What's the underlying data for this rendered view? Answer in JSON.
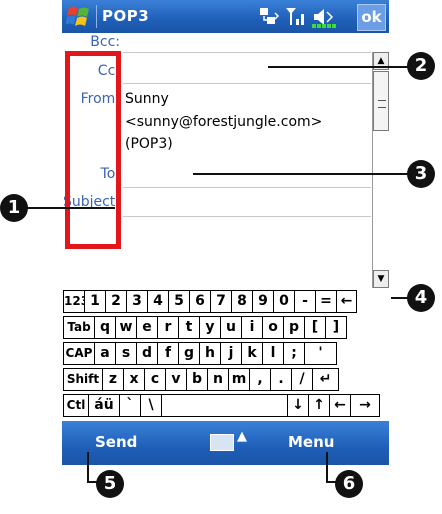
{
  "titlebar": {
    "title": "POP3",
    "ok_label": "ok"
  },
  "form": {
    "bcc_label": "Bcc:",
    "cc_label": "Cc:",
    "from_label": "From:",
    "from_name": "Sunny",
    "from_email": "<sunny@forestjungle.com>",
    "from_account": "(POP3)",
    "to_label": "To:",
    "subject_label": "Subject:"
  },
  "keyboard": {
    "rows": [
      [
        "123",
        "1",
        "2",
        "3",
        "4",
        "5",
        "6",
        "7",
        "8",
        "9",
        "0",
        "-",
        "=",
        "←"
      ],
      [
        "Tab",
        "q",
        "w",
        "e",
        "r",
        "t",
        "y",
        "u",
        "i",
        "o",
        "p",
        "[",
        "]"
      ],
      [
        "CAP",
        "a",
        "s",
        "d",
        "f",
        "g",
        "h",
        "j",
        "k",
        "l",
        ";",
        "'"
      ],
      [
        "Shift",
        "z",
        "x",
        "c",
        "v",
        "b",
        "n",
        "m",
        ",",
        ".",
        "/",
        "↵"
      ],
      [
        "Ctl",
        "áü",
        "`",
        "\\",
        "",
        "↓",
        "↑",
        "←",
        "→"
      ]
    ]
  },
  "bottombar": {
    "left_label": "Send",
    "right_label": "Menu"
  },
  "callouts": [
    "1",
    "2",
    "3",
    "4",
    "5",
    "6"
  ],
  "colors": {
    "accent": "#1f5fb8",
    "label": "#3a64b4",
    "highlight": "#e1171c"
  }
}
